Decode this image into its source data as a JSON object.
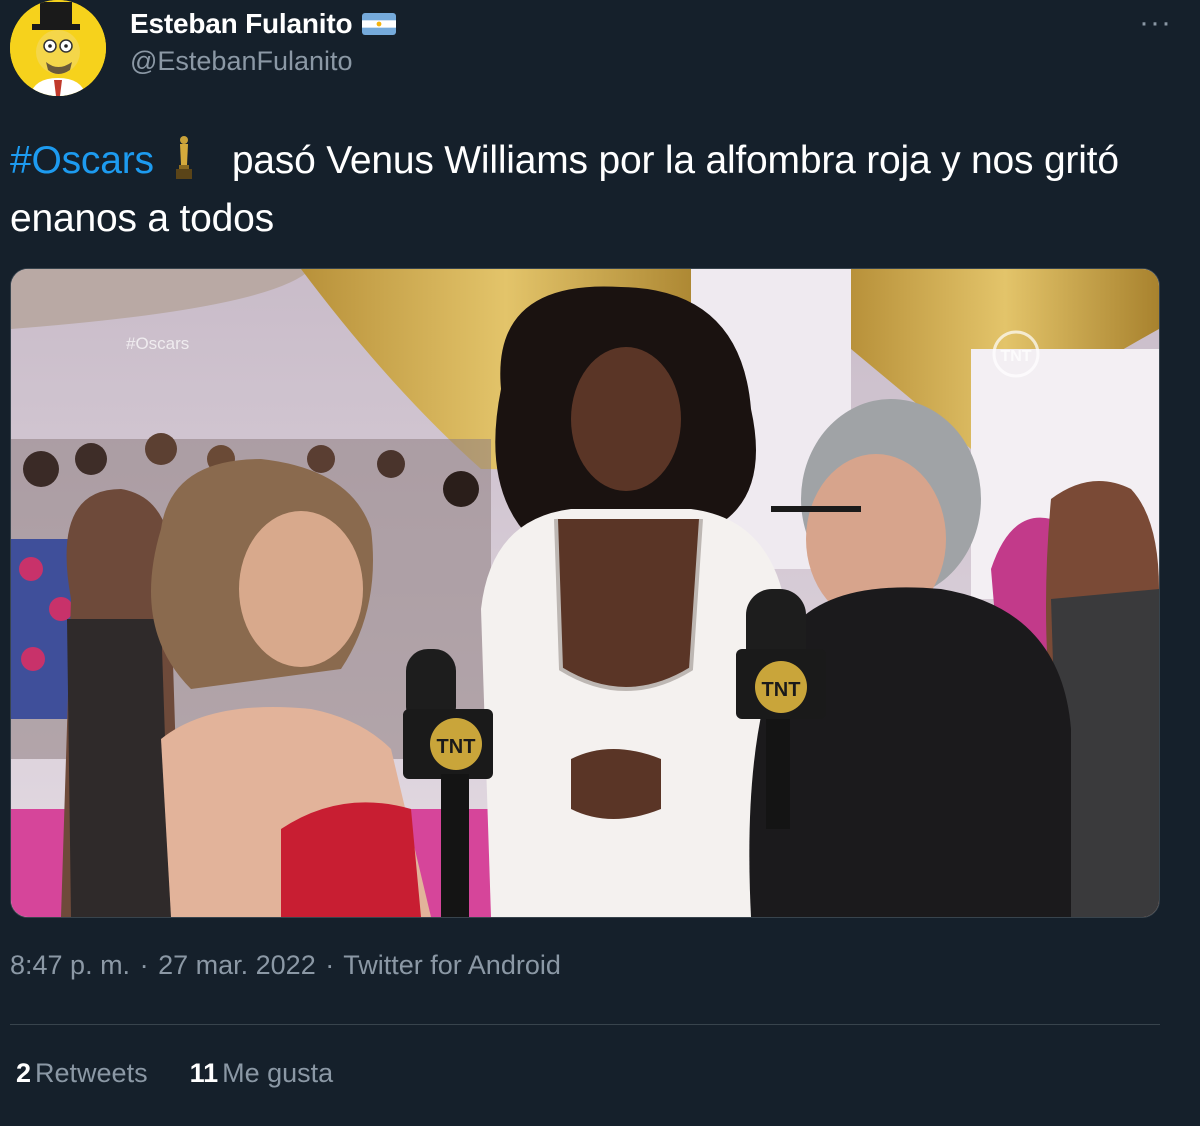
{
  "user": {
    "display_name": "Esteban Fulanito",
    "handle": "@EstebanFulanito",
    "flag_icon": "argentina-flag-icon",
    "avatar_icon": "cartoon-avatar-icon"
  },
  "more_label": "···",
  "tweet": {
    "hashtag": "#Oscars",
    "text_after_emoji": "pasó Venus Williams por la alfombra roja y nos gritó enanos a todos",
    "emoji_icon": "oscar-statuette-icon"
  },
  "media": {
    "watermark": "#Oscars",
    "mic_left_label": "TNT",
    "mic_right_label": "TNT",
    "channel_logo": "TNT"
  },
  "meta": {
    "time": "8:47 p. m.",
    "separator": "·",
    "date": "27 mar. 2022",
    "source": "Twitter for Android"
  },
  "stats": {
    "retweets_count": "2",
    "retweets_label": "Retweets",
    "likes_count": "11",
    "likes_label": "Me gusta"
  },
  "colors": {
    "background": "#15202b",
    "accent": "#1d9bf0",
    "secondary_text": "#8b98a5"
  }
}
